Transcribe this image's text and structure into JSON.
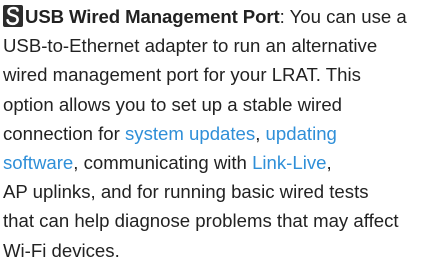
{
  "icon": {
    "name": "usb-port-icon",
    "color": "#2d2d2d"
  },
  "title": "USB Wired Management Port",
  "colon": ":",
  "lines": {
    "l1_tail": " You can use a",
    "l2": "USB-to-Ethernet adapter to run an alternative",
    "l3": "wired management port for your LRAT. This",
    "l4": "option allows you to set up a stable wired",
    "l5_pre": "connection for ",
    "l5_mid": ", ",
    "l6_tail": ", communicating with ",
    "l6_end": ",",
    "l7": "AP uplinks, and for running basic wired tests",
    "l8": "that can help diagnose problems that may affect",
    "l9": "Wi-Fi devices."
  },
  "links": {
    "system_updates": "system updates",
    "updating": "updating",
    "software": "software",
    "link_live": "Link-Live"
  },
  "colors": {
    "text": "#222222",
    "link": "#2f8fd8"
  }
}
